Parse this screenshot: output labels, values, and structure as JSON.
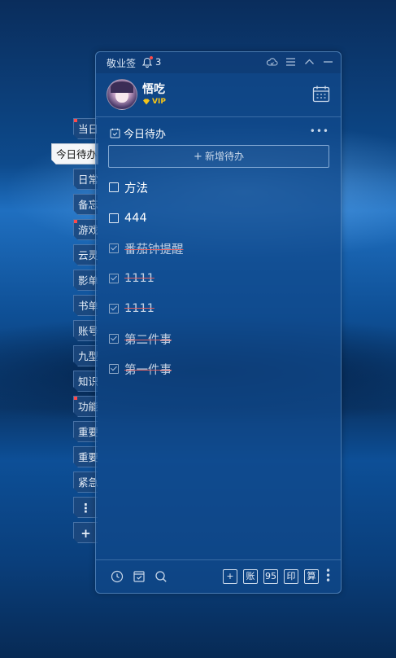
{
  "side_tabs": [
    {
      "label": "当日",
      "has_dot": true
    },
    {
      "label": "今日待办",
      "active": true
    },
    {
      "label": "日常"
    },
    {
      "label": "备忘"
    },
    {
      "label": "游戏",
      "has_dot": true
    },
    {
      "label": "云灵"
    },
    {
      "label": "影单"
    },
    {
      "label": "书单"
    },
    {
      "label": "账号"
    },
    {
      "label": "九型"
    },
    {
      "label": "知识"
    },
    {
      "label": "功能",
      "has_dot": true
    },
    {
      "label": "重要"
    },
    {
      "label": "重要"
    },
    {
      "label": "紧急"
    }
  ],
  "side_buttons": {
    "more_label": "⋮",
    "add_label": "+"
  },
  "titlebar": {
    "app_name": "敬业签",
    "notification_count": "3"
  },
  "user": {
    "name": "悟吃",
    "badge": "VIP"
  },
  "section": {
    "title": "今日待办",
    "more_label": "•••"
  },
  "add_button": {
    "icon": "+",
    "label": "新增待办"
  },
  "todos": [
    {
      "text": "方法",
      "done": false
    },
    {
      "text": "444",
      "done": false
    },
    {
      "text": "番茄钟提醒",
      "done": true
    },
    {
      "text": "1111",
      "done": true
    },
    {
      "text": "1111",
      "done": true
    },
    {
      "text": "第二件事",
      "done": true
    },
    {
      "text": "第一件事",
      "done": true
    }
  ],
  "bottom_buttons": {
    "add": "+",
    "account": "账",
    "num": "95",
    "print": "印",
    "calc": "算"
  },
  "colors": {
    "accent": "#f5c518",
    "strike": "#e06060",
    "panel": "#104a8c"
  }
}
